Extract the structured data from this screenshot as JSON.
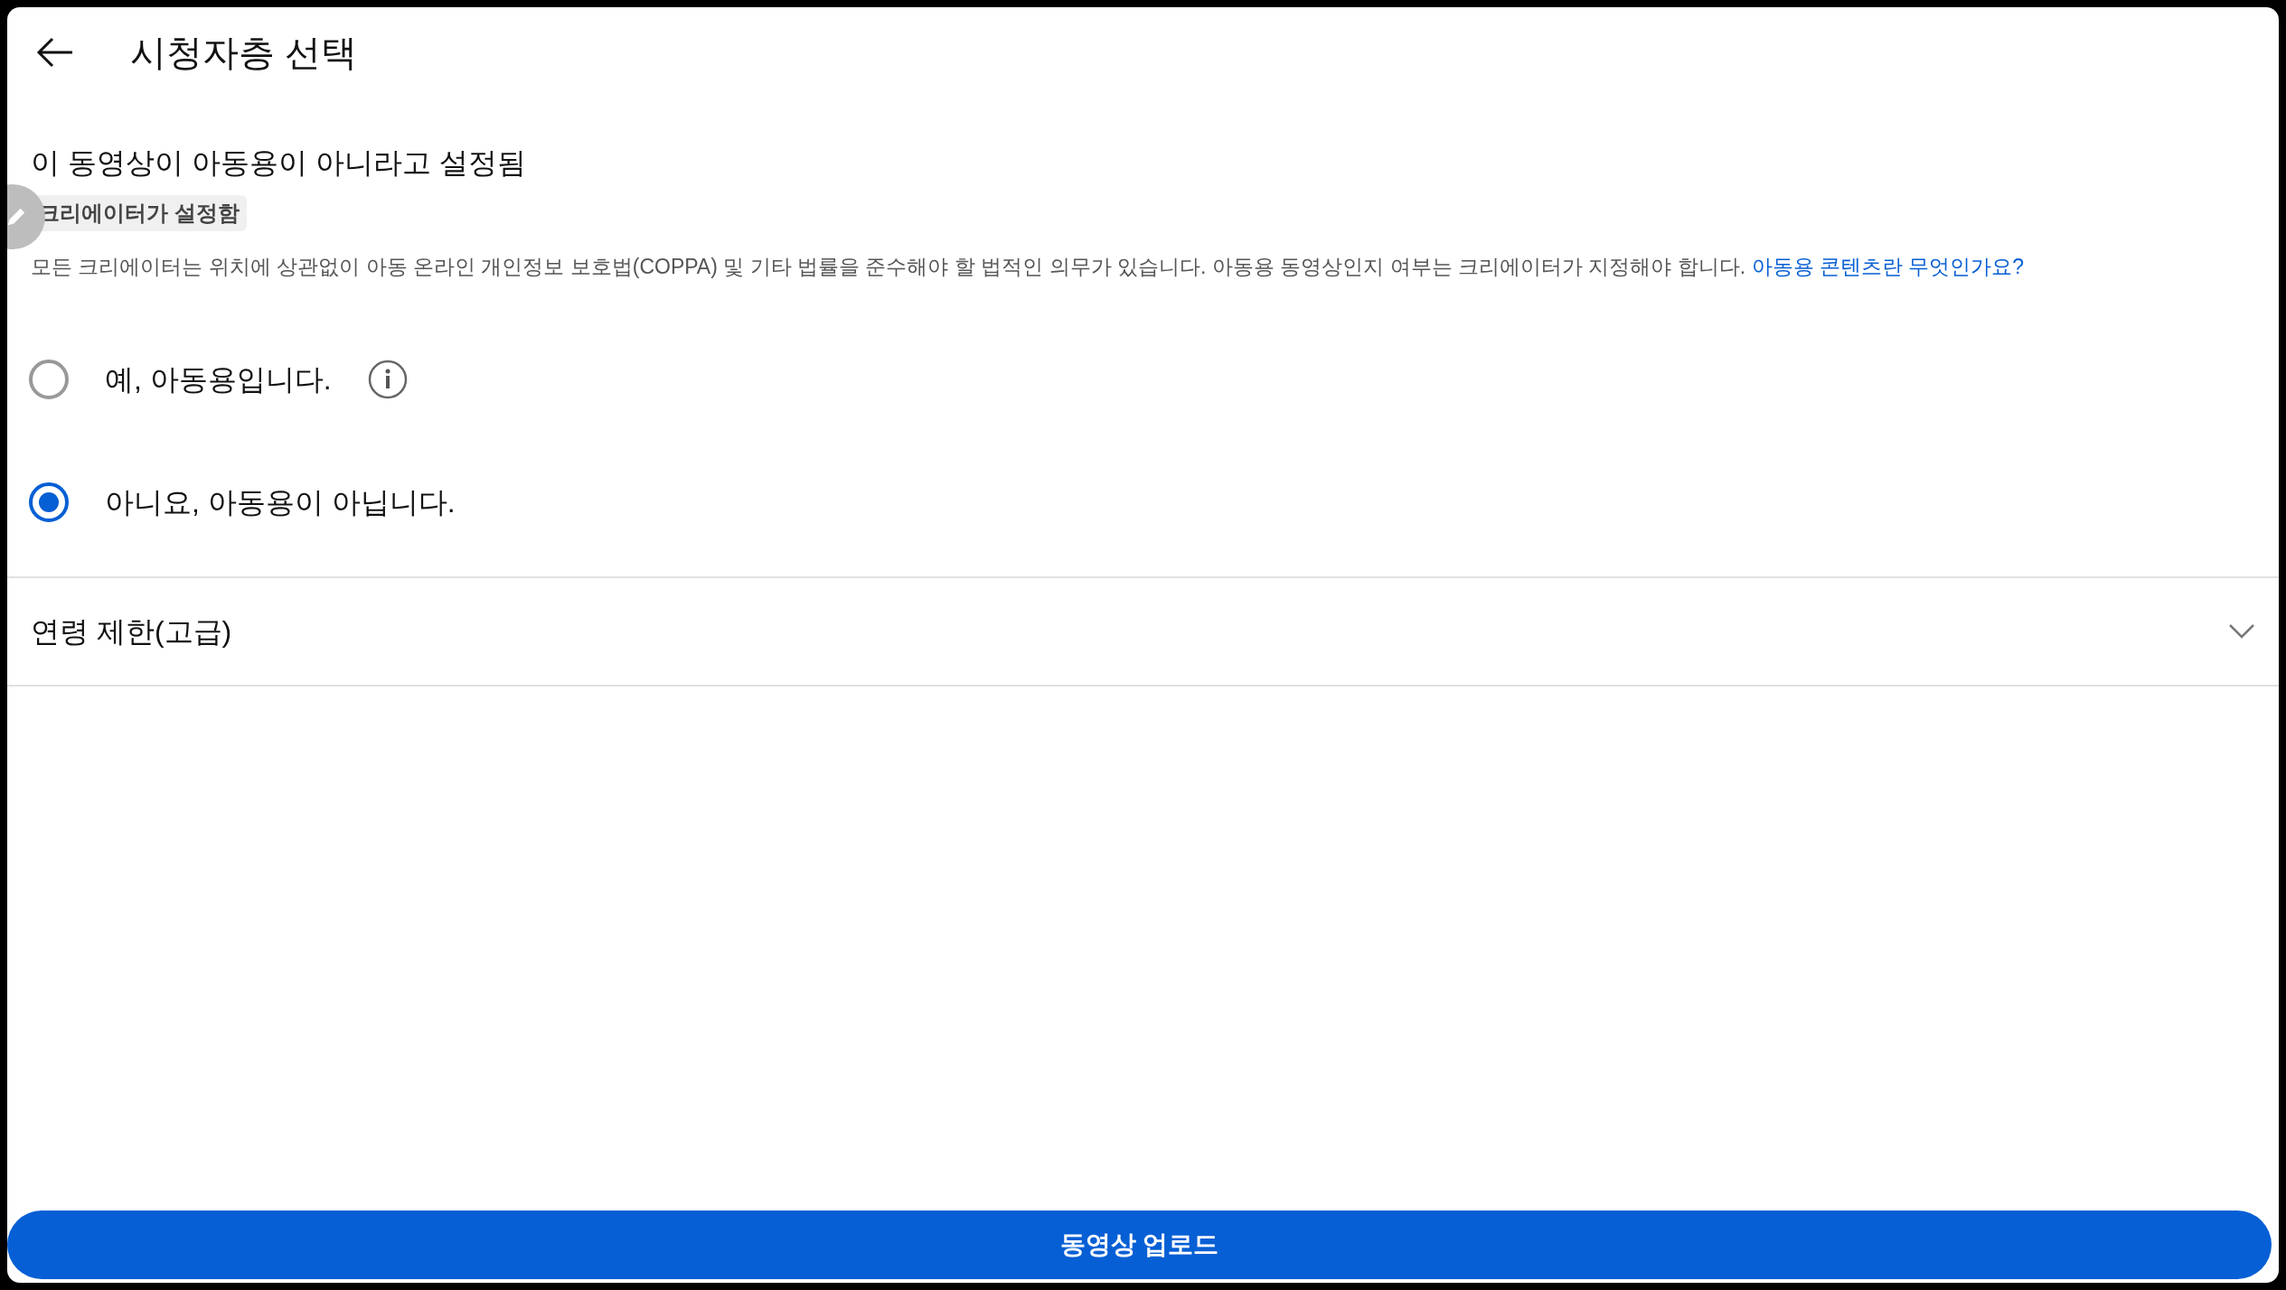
{
  "header": {
    "title": "시청자층 선택"
  },
  "status": {
    "heading": "이 동영상이 아동용이 아니라고 설정됨",
    "badge": "크리에이터가 설정함"
  },
  "description": {
    "text": "모든 크리에이터는 위치에 상관없이 아동 온라인 개인정보 보호법(COPPA) 및 기타 법률을 준수해야 할 법적인 의무가 있습니다. 아동용 동영상인지 여부는 크리에이터가 지정해야 합니다.",
    "link": "아동용 콘텐츠란 무엇인가요?"
  },
  "options": [
    {
      "label": "예, 아동용입니다.",
      "selected": false,
      "info": true
    },
    {
      "label": "아니요, 아동용이 아닙니다.",
      "selected": true,
      "info": false
    }
  ],
  "accordion": {
    "label": "연령 제한(고급)",
    "expanded": false
  },
  "upload_button": "동영상 업로드"
}
